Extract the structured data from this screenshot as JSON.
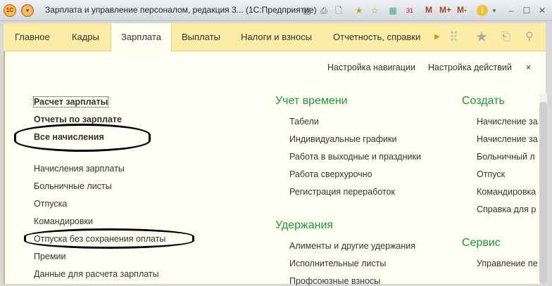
{
  "window": {
    "title": "Зарплата и управление персоналом, редакция 3... (1С:Предприятие)",
    "logo": "1С",
    "m": "M",
    "mplus": "M+",
    "mminus": "M-",
    "calendar_day": "31"
  },
  "tabs": [
    "Главное",
    "Кадры",
    "Зарплата",
    "Выплаты",
    "Налоги и взносы",
    "Отчетность, справки"
  ],
  "panel": {
    "nav_settings": "Настройка навигации",
    "action_settings": "Настройка действий",
    "close": "×"
  },
  "left": [
    "Расчет зарплаты",
    "Отчеты по зарплате",
    "Все начисления",
    "Начисления зарплаты",
    "Больничные листы",
    "Отпуска",
    "Командировки",
    "Отпуска без сохранения оплаты",
    "Премии",
    "Данные для расчета зарплаты"
  ],
  "time": {
    "heading": "Учет времени",
    "items": [
      "Табели",
      "Индивидуальные графики",
      "Работа в выходные и праздники",
      "Работа сверхурочно",
      "Регистрация переработок"
    ]
  },
  "deductions": {
    "heading": "Удержания",
    "items": [
      "Алименты и другие удержания",
      "Исполнительные листы",
      "Профсоюзные взносы"
    ]
  },
  "create": {
    "heading": "Создать",
    "items": [
      "Начисление за",
      "Начисление за",
      "Больничный л",
      "Отпуск",
      "Командировка",
      "Справка для р"
    ]
  },
  "service": {
    "heading": "Сервис",
    "items": [
      "Управление пе"
    ]
  },
  "colors": {
    "accent": "#1a9a3c",
    "tabbar": "#fbeda6"
  }
}
